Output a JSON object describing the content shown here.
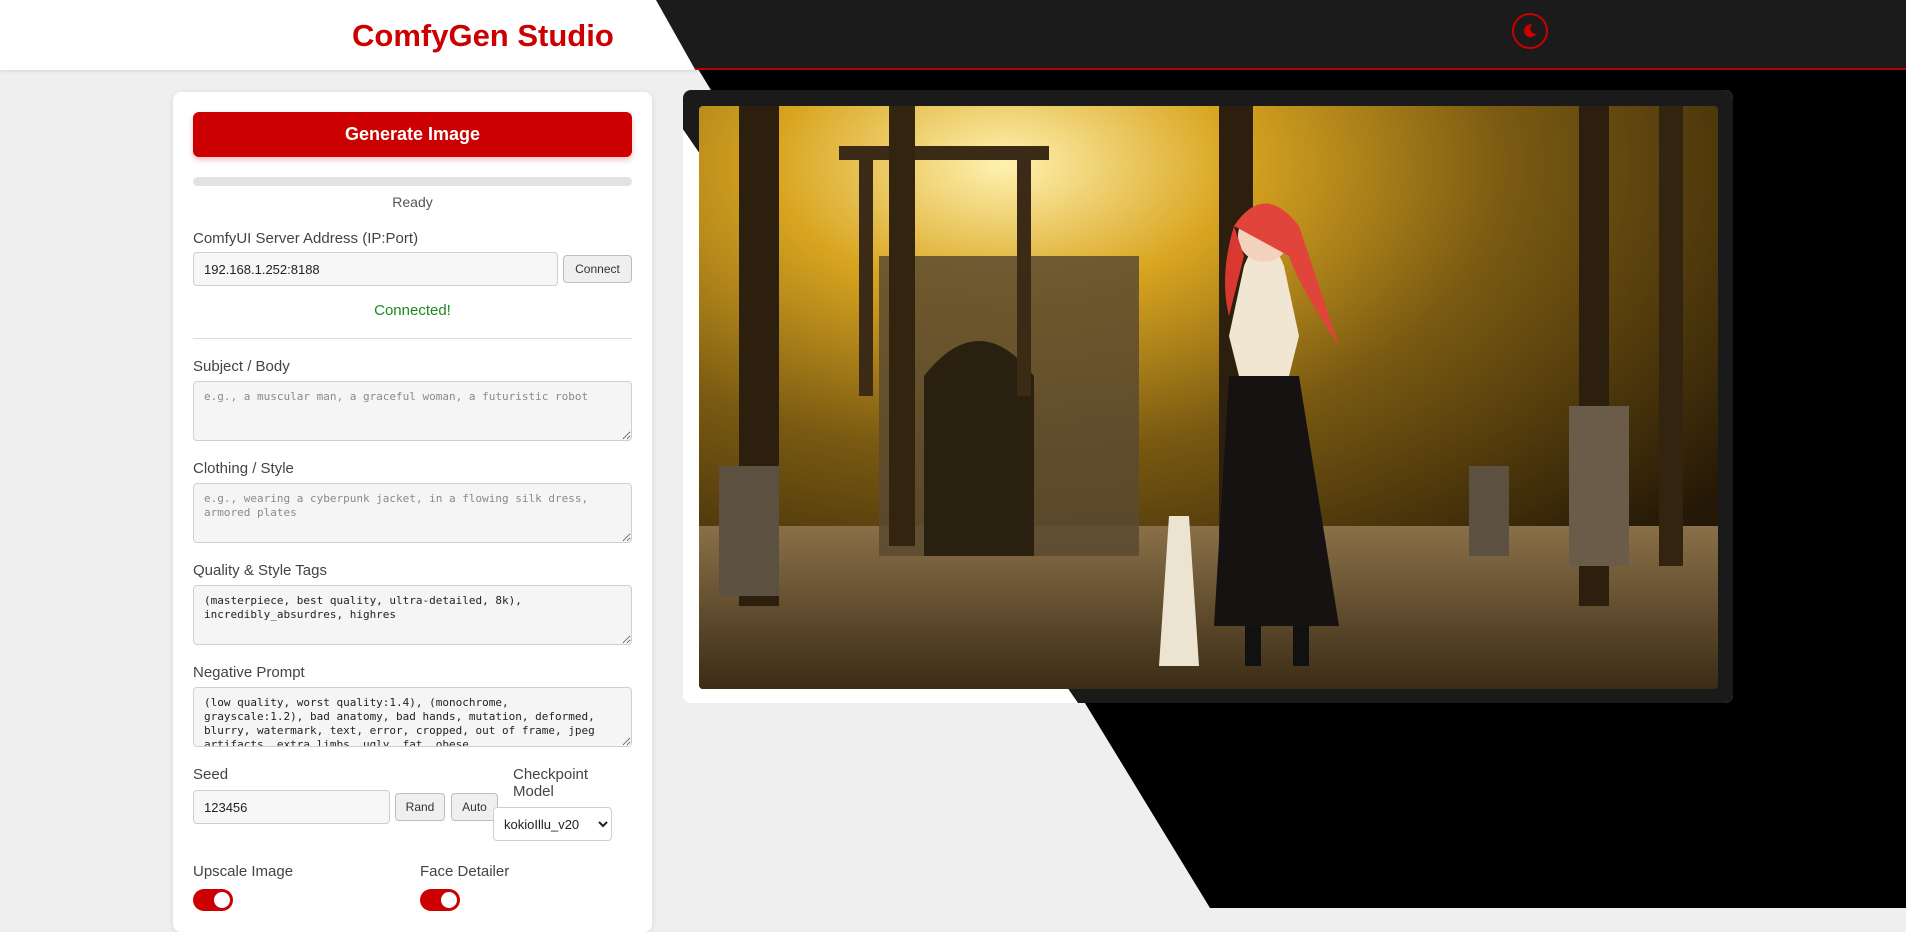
{
  "app": {
    "title": "ComfyGen Studio"
  },
  "header": {
    "theme_toggle_icon": "moon-icon"
  },
  "controls": {
    "generate_label": "Generate Image",
    "progress": 0,
    "status": "Ready"
  },
  "server": {
    "label": "ComfyUI Server Address (IP:Port)",
    "value": "192.168.1.252:8188",
    "connect_label": "Connect",
    "status": "Connected!"
  },
  "prompts": {
    "subject": {
      "label": "Subject / Body",
      "placeholder": "e.g., a muscular man, a graceful woman, a futuristic robot"
    },
    "clothing": {
      "label": "Clothing / Style",
      "placeholder": "e.g., wearing a cyberpunk jacket, in a flowing silk dress, armored plates"
    },
    "quality": {
      "label": "Quality & Style Tags",
      "value": "(masterpiece, best quality, ultra-detailed, 8k), incredibly_absurdres, highres"
    },
    "negative": {
      "label": "Negative Prompt",
      "value": "(low quality, worst quality:1.4), (monochrome, grayscale:1.2), bad anatomy, bad hands, mutation, deformed, blurry, watermark, text, error, cropped, out of frame, jpeg artifacts, extra limbs, ugly, fat, obese"
    }
  },
  "seed": {
    "label": "Seed",
    "value": "123456",
    "rand_label": "Rand",
    "auto_label": "Auto"
  },
  "checkpoint": {
    "label": "Checkpoint Model",
    "selected": "kokioIllu_v20"
  },
  "toggles": {
    "upscale": {
      "label": "Upscale Image",
      "on": true
    },
    "face_detailer": {
      "label": "Face Detailer",
      "on": true
    }
  },
  "output": {
    "image_icon": "generated-image"
  },
  "colors": {
    "accent": "#cc0000",
    "success": "#1e8a1e",
    "dark": "#1b1b1b"
  }
}
